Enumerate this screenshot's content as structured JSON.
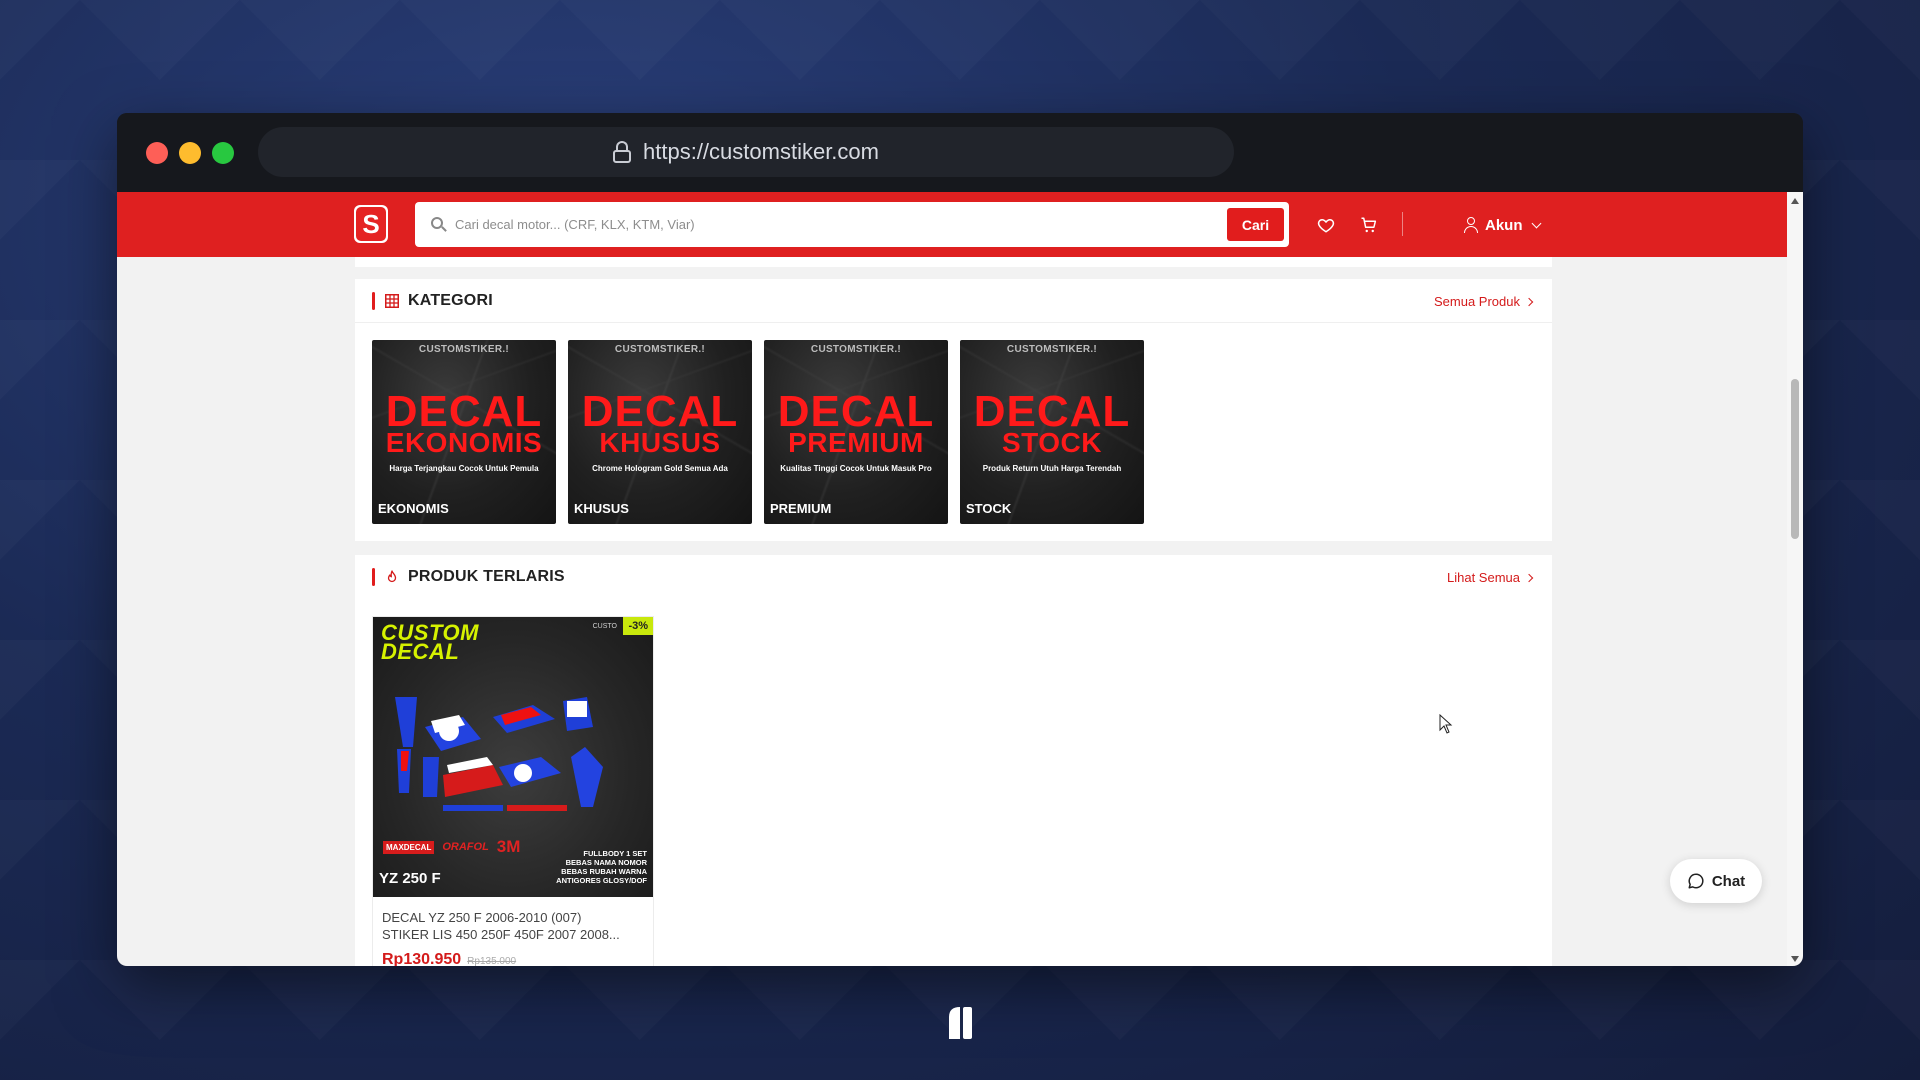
{
  "browser": {
    "url": "https://customstiker.com"
  },
  "header": {
    "logo_letter": "S",
    "search_placeholder": "Cari decal motor... (CRF, KLX, KTM, Viar)",
    "search_button": "Cari",
    "account_label": "Akun"
  },
  "kategori": {
    "title": "KATEGORI",
    "link": "Semua Produk",
    "items": [
      {
        "brand": "CUSTOMSTIKER.!",
        "big1": "DECAL",
        "big2": "EKONOMIS",
        "tagline": "Harga Terjangkau   Cocok Untuk Pemula",
        "label": "EKONOMIS"
      },
      {
        "brand": "CUSTOMSTIKER.!",
        "big1": "DECAL",
        "big2": "KHUSUS",
        "tagline": "Chrome   Hologram   Gold   Semua Ada",
        "label": "KHUSUS"
      },
      {
        "brand": "CUSTOMSTIKER.!",
        "big1": "DECAL",
        "big2": "PREMIUM",
        "tagline": "Kualitas Tinggi   Cocok Untuk Masuk Pro",
        "label": "PREMIUM"
      },
      {
        "brand": "CUSTOMSTIKER.!",
        "big1": "DECAL",
        "big2": "STOCK",
        "tagline": "Produk Return Utuh   Harga Terendah",
        "label": "STOCK"
      }
    ]
  },
  "produk": {
    "title": "PRODUK TERLARIS",
    "link": "Lihat Semua",
    "items": [
      {
        "image_title_line1": "CUSTOM",
        "image_title_line2": "DECAL",
        "image_brand": "CUSTO",
        "discount": "-3%",
        "model": "YZ 250 F",
        "sponsor_a": "MAXDECAL",
        "sponsor_b": "ORAFOL",
        "sponsor_c": "3M",
        "footer_line1": "FULLBODY 1 SET",
        "footer_line2": "BEBAS NAMA NOMOR",
        "footer_line3": "BEBAS RUBAH WARNA",
        "footer_line4": "ANTIGORES GLOSY/DOF",
        "name_line1": "DECAL YZ 250 F 2006-2010 (007)",
        "name_line2": "STIKER LIS 450 250F 450F 2007 2008...",
        "price": "Rp130.950",
        "old_price": "Rp135.000"
      }
    ]
  },
  "chat": {
    "label": "Chat"
  },
  "colors": {
    "brand_red": "#df2020",
    "accent_red": "#d41b1b",
    "discount_lime": "#c8e80c"
  }
}
